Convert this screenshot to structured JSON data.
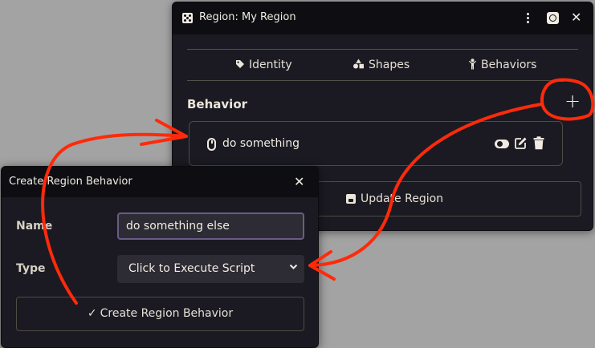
{
  "region_window": {
    "title": "Region: My Region",
    "tabs": [
      {
        "label": "Identity",
        "icon": "tag-icon"
      },
      {
        "label": "Shapes",
        "icon": "shapes-icon"
      },
      {
        "label": "Behaviors",
        "icon": "child-reaching-icon"
      }
    ],
    "section_title": "Behavior",
    "add_label": "+",
    "behaviors": [
      {
        "name": "do something",
        "icon": "mouse-icon"
      }
    ],
    "update_button": "Update Region"
  },
  "create_window": {
    "title": "Create Region Behavior",
    "name_label": "Name",
    "name_value": "do something else",
    "type_label": "Type",
    "type_value": "Click to Execute Script",
    "submit_label": "Create Region Behavior"
  },
  "icons": {
    "close": "✕",
    "chevron": "⌄",
    "check": "✓"
  },
  "colors": {
    "window_bg": "#1b1a22",
    "header_bg": "#0e0e12",
    "text": "#f0ebe2",
    "input_focus": "#6a5c86",
    "annotation": "#ff2a0a",
    "desktop": "#a3a3a3"
  }
}
